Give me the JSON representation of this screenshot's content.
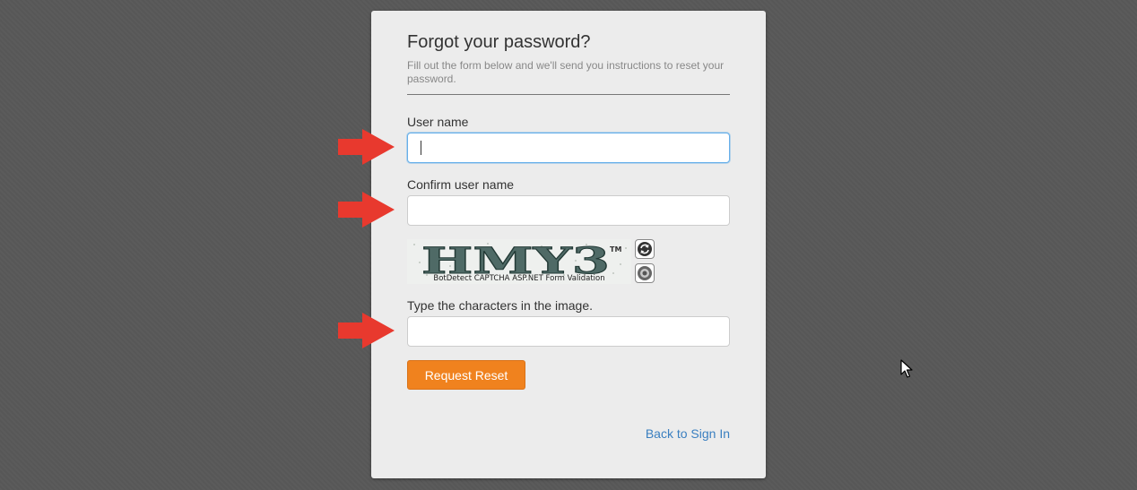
{
  "form": {
    "title": "Forgot your password?",
    "subtitle": "Fill out the form below and we'll send you instructions to reset your password.",
    "username_label": "User name",
    "username_value": "",
    "confirm_label": "Confirm user name",
    "confirm_value": "",
    "captcha": {
      "text": "HMY3",
      "trademark": "TM",
      "caption": "BotDetect CAPTCHA ASP.NET Form Validation",
      "reload_icon": "reload-icon",
      "sound_icon": "speaker-icon"
    },
    "captcha_label": "Type the characters in the image.",
    "captcha_value": "",
    "submit_label": "Request Reset",
    "back_link": "Back to Sign In"
  },
  "annotations": {
    "arrow_color": "#e8392e",
    "arrow_icon": "right-arrow-icon"
  },
  "theme": {
    "background": "#575757",
    "card": "#ececec",
    "accent": "#f0821e",
    "link": "#3a7fc0"
  }
}
